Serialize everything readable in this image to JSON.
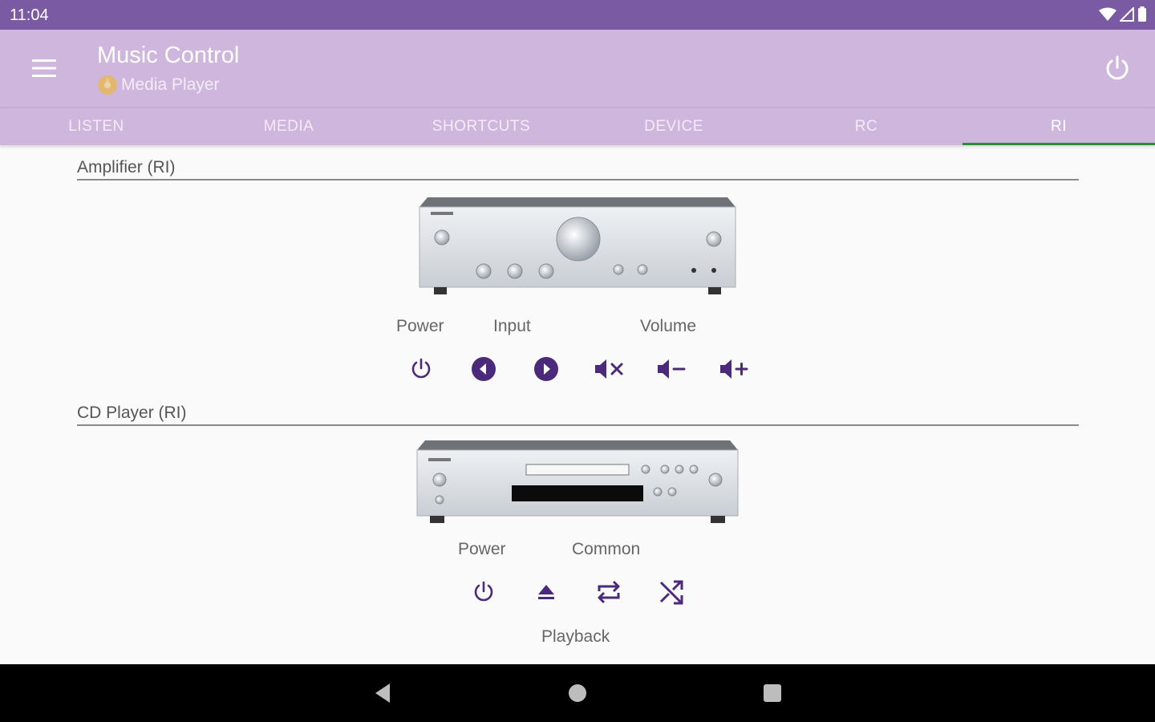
{
  "status": {
    "time": "11:04"
  },
  "app": {
    "title": "Music Control",
    "subtitle": "Media Player"
  },
  "tabs": [
    {
      "label": "LISTEN"
    },
    {
      "label": "MEDIA"
    },
    {
      "label": "SHORTCUTS"
    },
    {
      "label": "DEVICE"
    },
    {
      "label": "RC"
    },
    {
      "label": "RI",
      "active": true
    }
  ],
  "amplifier": {
    "title": "Amplifier (RI)",
    "labels": {
      "power": "Power",
      "input": "Input",
      "volume": "Volume"
    }
  },
  "cd": {
    "title": "CD Player (RI)",
    "labels": {
      "power": "Power",
      "common": "Common",
      "playback": "Playback"
    }
  },
  "colors": {
    "statusbar": "#7a5ba3",
    "appbar": "#cfb6dd",
    "icon": "#4b2a7b",
    "tab_indicator": "#2e8b3e"
  }
}
